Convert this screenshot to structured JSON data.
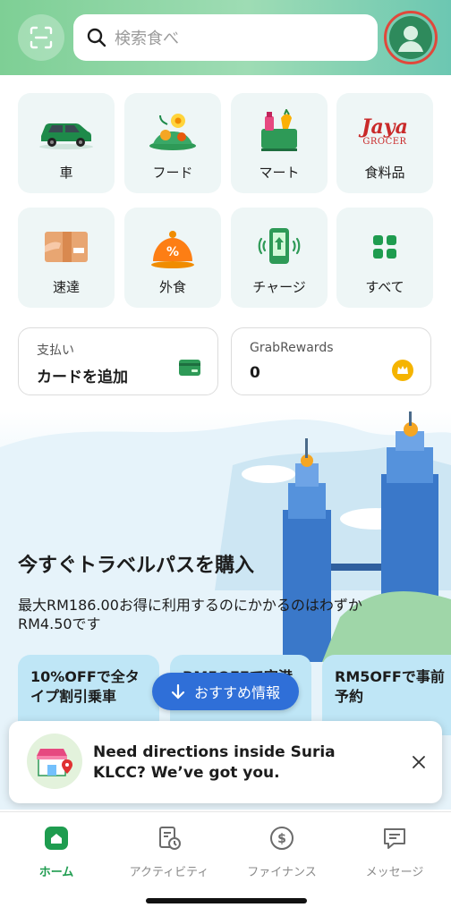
{
  "header": {
    "search_placeholder": "検索食べ",
    "scan_icon": "scan-icon",
    "avatar_icon": "profile-avatar-icon"
  },
  "services": [
    {
      "label": "車",
      "icon": "car-icon"
    },
    {
      "label": "フード",
      "icon": "food-icon"
    },
    {
      "label": "マート",
      "icon": "mart-icon"
    },
    {
      "label": "食料品",
      "icon": "jaya-grocer-logo",
      "logo_line1": "Jaya",
      "logo_line2": "GROCER"
    },
    {
      "label": "速達",
      "icon": "express-icon"
    },
    {
      "label": "外食",
      "icon": "dine-out-icon"
    },
    {
      "label": "チャージ",
      "icon": "topup-icon"
    },
    {
      "label": "すべて",
      "icon": "all-services-icon"
    }
  ],
  "payment": {
    "label": "支払い",
    "action": "カードを追加",
    "icon": "card-icon"
  },
  "rewards": {
    "label": "GrabRewards",
    "points": "0",
    "icon": "crown-icon"
  },
  "banner": {
    "title": "今すぐトラベルパスを購入",
    "subtitle": "最大RM186.00お得に利用するのにかかるのはわずかRM4.50です",
    "promos": [
      "10%OFFで全タイプ割引乗車",
      "RM5OFFで空港",
      "RM5OFFで事前予約"
    ],
    "recommend_label": "おすすめ情報"
  },
  "toast": {
    "message": "Need directions inside Suria KLCC? We’ve got you.",
    "icon": "mall-location-icon"
  },
  "nav": [
    {
      "label": "ホーム",
      "icon": "home-icon",
      "active": true
    },
    {
      "label": "アクティビティ",
      "icon": "activity-icon",
      "active": false
    },
    {
      "label": "ファイナンス",
      "icon": "finance-icon",
      "active": false
    },
    {
      "label": "メッセージ",
      "icon": "message-icon",
      "active": false
    }
  ],
  "colors": {
    "brand_green": "#1e9c4f",
    "header_green": "#7ecf95",
    "highlight_red": "#e0483b",
    "recommend_blue": "#2f6fd8"
  }
}
